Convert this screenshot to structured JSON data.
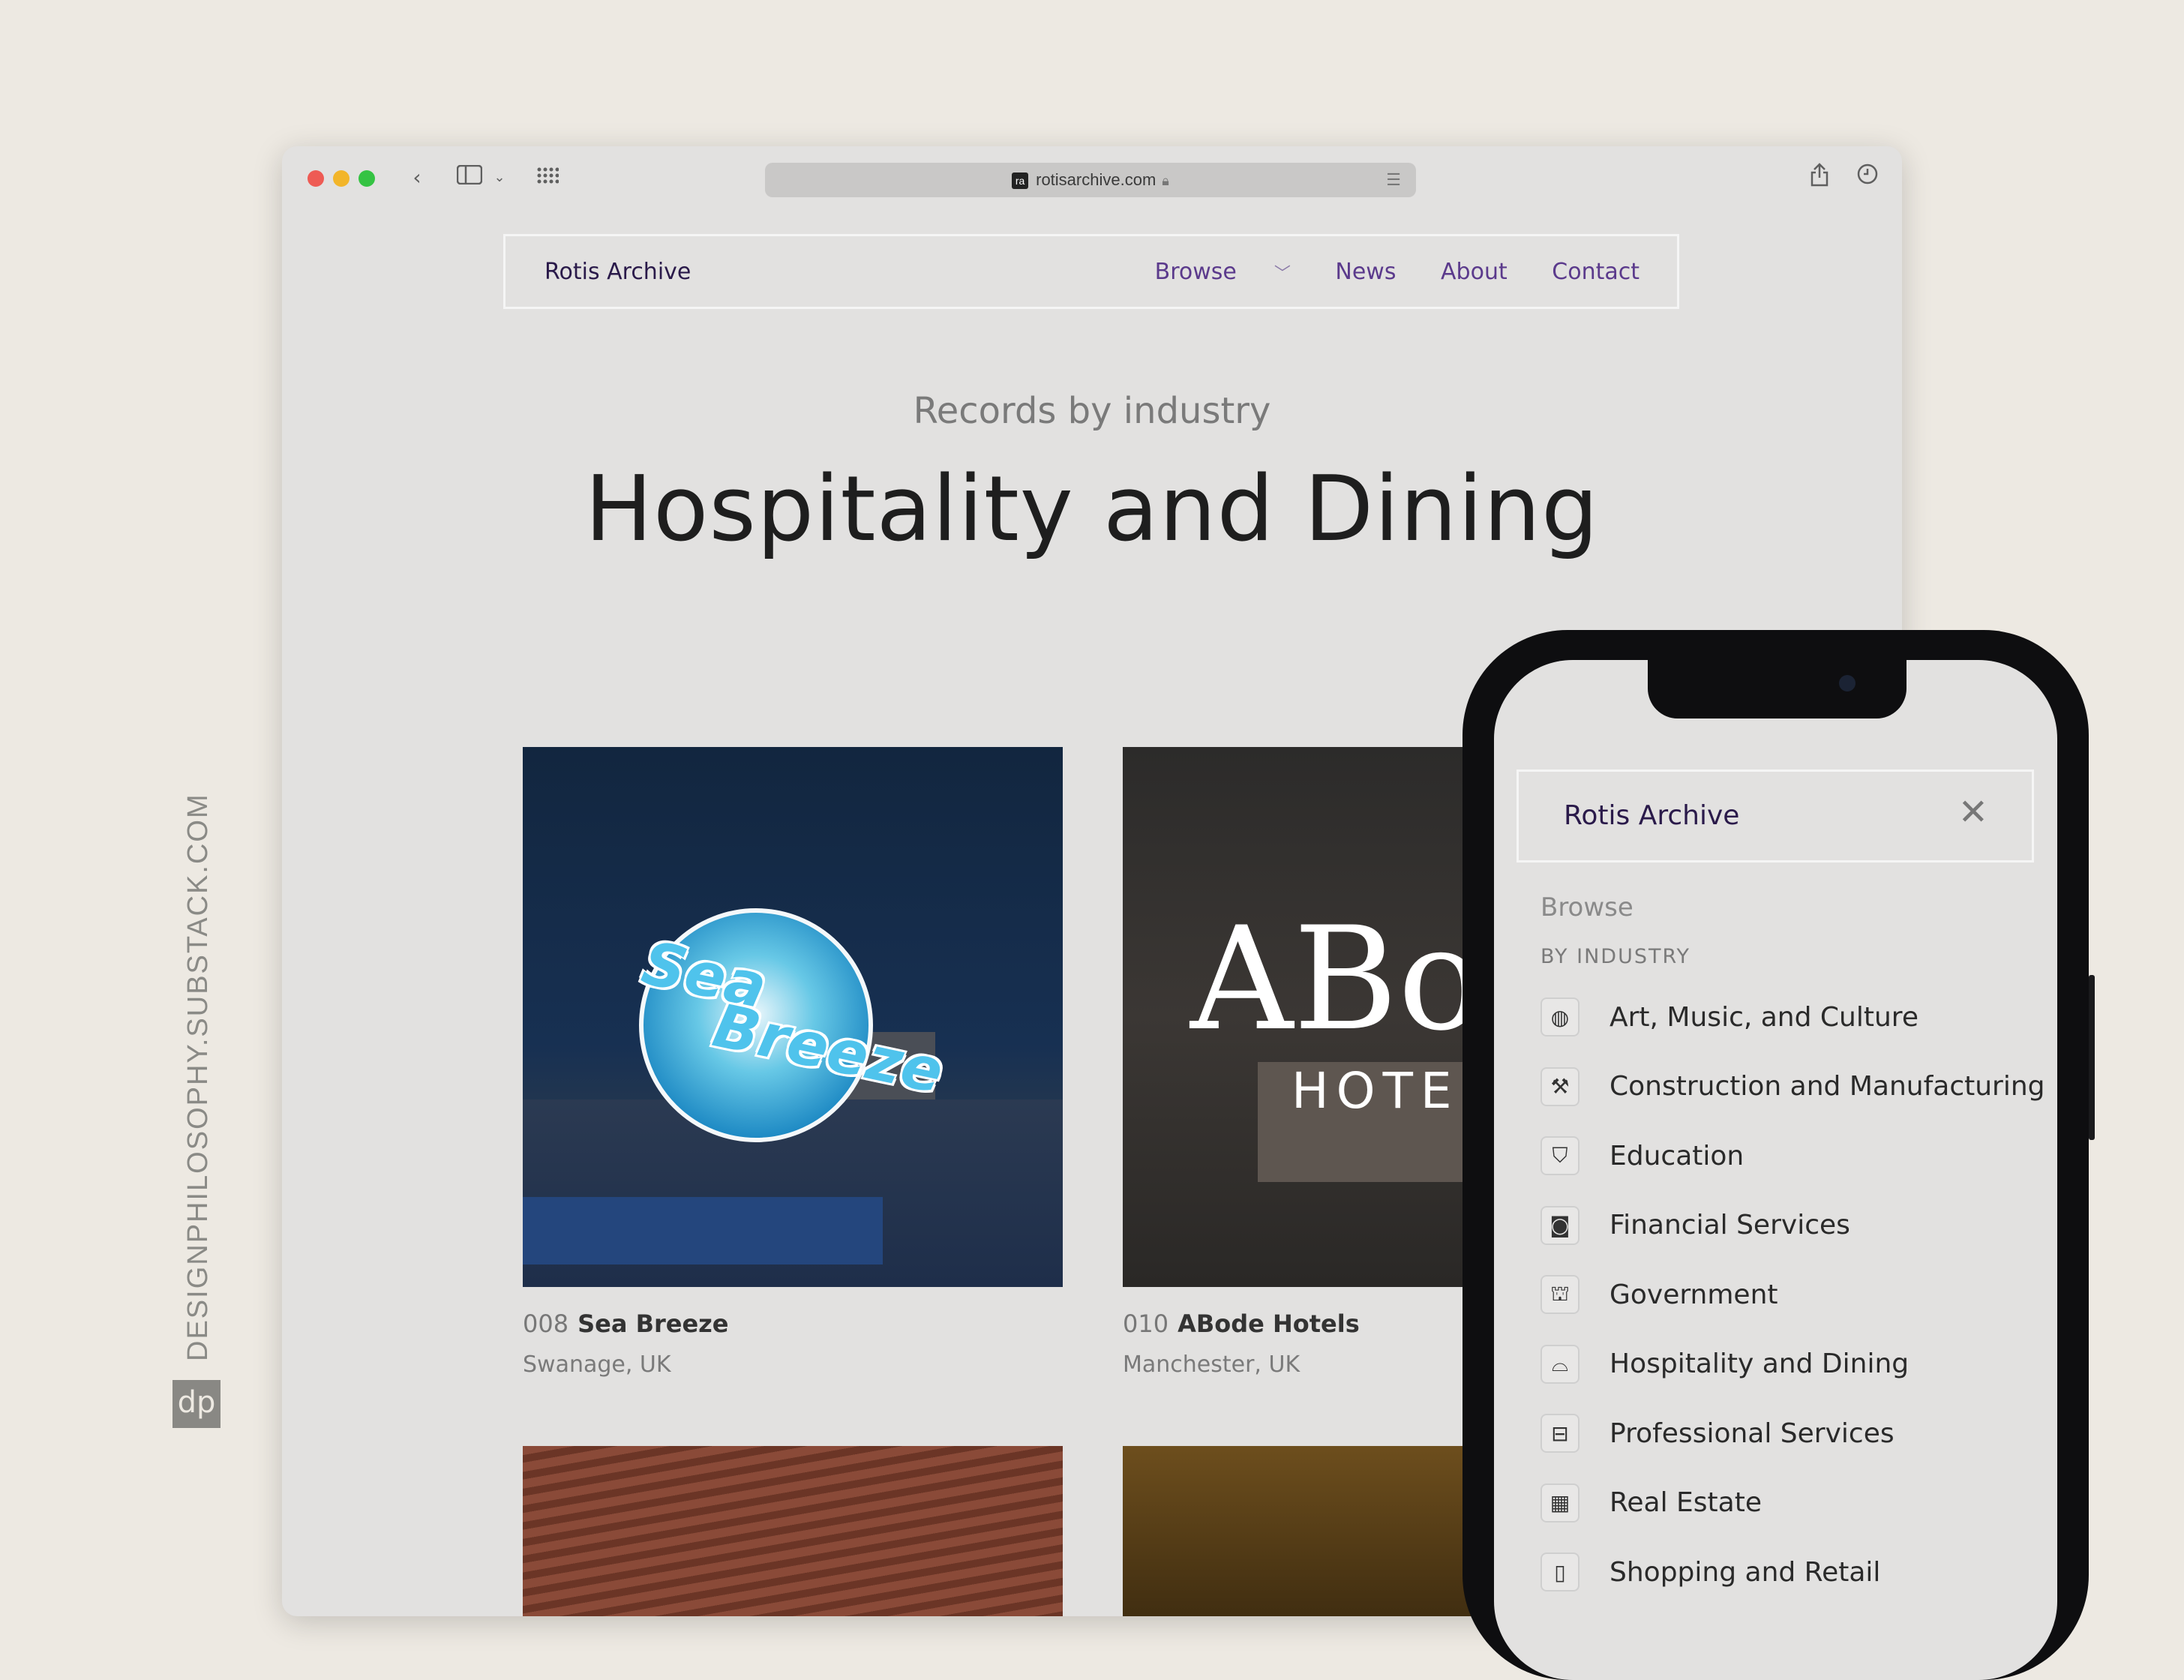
{
  "credit": {
    "text": "DESIGNPHILOSOPHY.SUBSTACK.COM",
    "logo": "dp"
  },
  "browser": {
    "url": "rotisarchive.com",
    "favicon_text": "ra",
    "icons": [
      "back-icon",
      "sidebar-icon",
      "chevron-down-icon",
      "tabs-grid-icon",
      "share-icon",
      "history-icon",
      "lock-icon",
      "reader-icon"
    ]
  },
  "site": {
    "brand": "Rotis Archive",
    "nav": {
      "browse": "Browse",
      "news": "News",
      "about": "About",
      "contact": "Contact"
    },
    "kicker": "Records by industry",
    "title": "Hospitality and Dining"
  },
  "cards": [
    {
      "number": "008",
      "name": "Sea Breeze",
      "location": "Swanage, UK",
      "logo_words": [
        "Sea",
        "Breeze"
      ]
    },
    {
      "number": "010",
      "name": "ABode Hotels",
      "location": "Manchester, UK",
      "logo_words": [
        "ABo",
        "HOTEL"
      ]
    }
  ],
  "mobile": {
    "brand": "Rotis Archive",
    "browse": "Browse",
    "section": "BY INDUSTRY",
    "items": [
      {
        "label": "Art, Music, and Culture",
        "icon": "globe-icon",
        "glyph": "◍"
      },
      {
        "label": "Construction and Manufacturing",
        "icon": "wrench-icon",
        "glyph": "⚒"
      },
      {
        "label": "Education",
        "icon": "graduation-cap-icon",
        "glyph": "⛉"
      },
      {
        "label": "Financial Services",
        "icon": "safe-icon",
        "glyph": "◙"
      },
      {
        "label": "Government",
        "icon": "building-columns-icon",
        "glyph": "⛫"
      },
      {
        "label": "Hospitality and Dining",
        "icon": "service-bell-icon",
        "glyph": "⌓"
      },
      {
        "label": "Professional Services",
        "icon": "briefcase-icon",
        "glyph": "⊟"
      },
      {
        "label": "Real Estate",
        "icon": "office-building-icon",
        "glyph": "▦"
      },
      {
        "label": "Shopping and Retail",
        "icon": "shopping-bag-icon",
        "glyph": "▯"
      }
    ]
  }
}
